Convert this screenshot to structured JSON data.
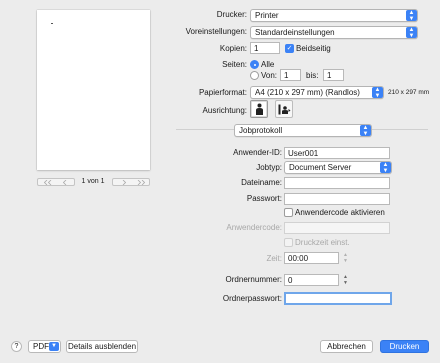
{
  "preview": {
    "page_label": "1 von 1",
    "first_icon": "double-chevron-left-icon",
    "prev_icon": "chevron-left-icon",
    "next_icon": "chevron-right-icon",
    "last_icon": "double-chevron-right-icon"
  },
  "printer": {
    "label": "Drucker:",
    "value": "Printer"
  },
  "presets": {
    "label": "Voreinstellungen:",
    "value": "Standardeinstellungen"
  },
  "copies": {
    "label": "Kopien:",
    "value": "1",
    "duplex_label": "Beidseitig",
    "duplex_checked": true
  },
  "pages": {
    "label": "Seiten:",
    "all_label": "Alle",
    "from_label": "Von:",
    "from_value": "1",
    "to_label": "bis:",
    "to_value": "1",
    "selected": "all"
  },
  "paper": {
    "label": "Papierformat:",
    "value": "A4 (210 x 297 mm) (Randlos)",
    "size_text": "210 x 297 mm"
  },
  "orientation": {
    "label": "Ausrichtung:",
    "selected": "portrait"
  },
  "section": {
    "value": "Jobprotokoll"
  },
  "job": {
    "user_id_label": "Anwender-ID:",
    "user_id_value": "User001",
    "job_type_label": "Jobtyp:",
    "job_type_value": "Document Server",
    "file_name_label": "Dateiname:",
    "file_name_value": "",
    "password_label": "Passwort:",
    "password_value": "",
    "activate_code_label": "Anwendercode aktivieren",
    "activate_code_checked": false,
    "user_code_label": "Anwendercode:",
    "user_code_value": "",
    "print_time_label": "Druckzeit einst.",
    "time_label": "Zeit:",
    "time_value": "00:00",
    "folder_number_label": "Ordnernummer:",
    "folder_number_value": "0",
    "folder_password_label": "Ordnerpasswort:",
    "folder_password_value": ""
  },
  "footer": {
    "help_symbol": "?",
    "pdf_label": "PDF",
    "hide_details_label": "Details ausblenden",
    "cancel_label": "Abbrechen",
    "print_label": "Drucken"
  },
  "colors": {
    "accent": "#3b82f6",
    "background": "#ececec",
    "focus_ring": "#6fa6ea"
  }
}
